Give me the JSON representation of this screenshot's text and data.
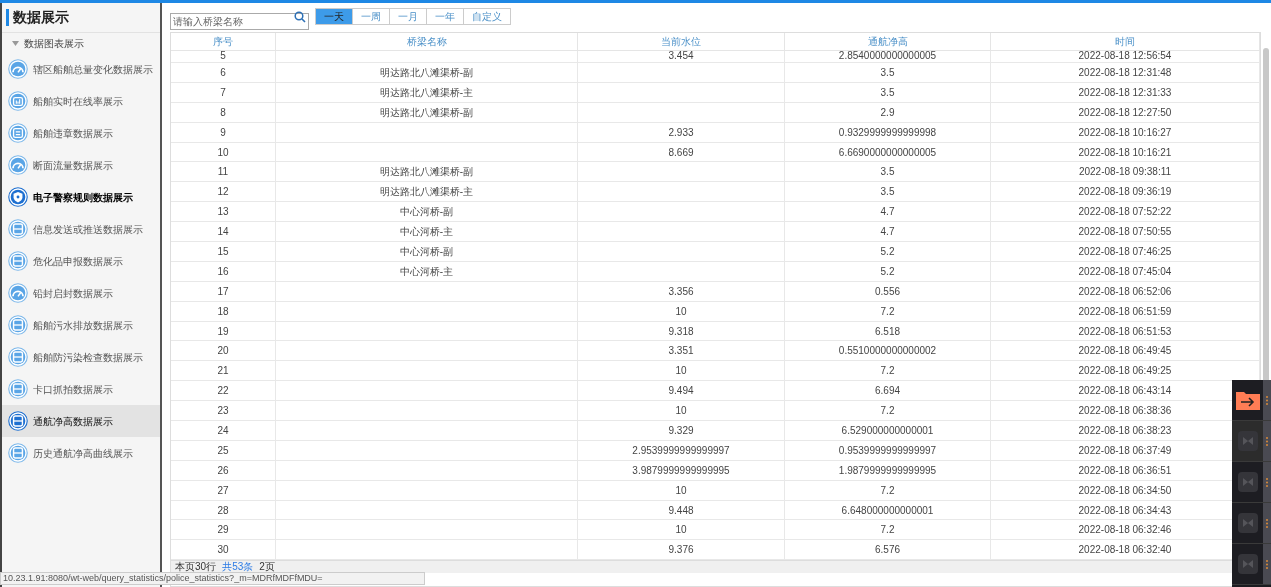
{
  "sidebar": {
    "title": "数据展示",
    "group": {
      "label": "数据图表展示",
      "expanded": true,
      "items": [
        {
          "label": "辖区船舶总量变化数据展示",
          "kind": "gauge",
          "selected": false,
          "emphasized": false
        },
        {
          "label": "船舶实时在线率展示",
          "kind": "bars",
          "selected": false,
          "emphasized": false
        },
        {
          "label": "船舶违章数据展示",
          "kind": "badge",
          "selected": false,
          "emphasized": false
        },
        {
          "label": "断面流量数据展示",
          "kind": "gauge",
          "selected": false,
          "emphasized": false
        },
        {
          "label": "电子警察规则数据展示",
          "kind": "shield",
          "selected": false,
          "emphasized": true
        },
        {
          "label": "信息发送或推送数据展示",
          "kind": "box",
          "selected": false,
          "emphasized": false
        },
        {
          "label": "危化品申报数据展示",
          "kind": "box",
          "selected": false,
          "emphasized": false
        },
        {
          "label": "铅封启封数据展示",
          "kind": "gauge",
          "selected": false,
          "emphasized": false
        },
        {
          "label": "船舶污水排放数据展示",
          "kind": "box",
          "selected": false,
          "emphasized": false
        },
        {
          "label": "船舶防污染检查数据展示",
          "kind": "box",
          "selected": false,
          "emphasized": false
        },
        {
          "label": "卡口抓拍数据展示",
          "kind": "box",
          "selected": false,
          "emphasized": false
        },
        {
          "label": "通航净高数据展示",
          "kind": "box",
          "selected": true,
          "emphasized": false
        },
        {
          "label": "历史通航净高曲线展示",
          "kind": "box",
          "selected": false,
          "emphasized": false
        }
      ]
    }
  },
  "search": {
    "placeholder": "请输入桥梁名称"
  },
  "ranges": [
    {
      "label": "一天",
      "selected": true
    },
    {
      "label": "一周",
      "selected": false
    },
    {
      "label": "一月",
      "selected": false
    },
    {
      "label": "一年",
      "selected": false
    },
    {
      "label": "自定义",
      "selected": false
    }
  ],
  "table": {
    "columns": [
      "序号",
      "桥梁名称",
      "当前水位",
      "通航净高",
      "时间"
    ],
    "rows": [
      [
        "5",
        "",
        "3.454",
        "2.8540000000000005",
        "2022-08-18 12:56:54"
      ],
      [
        "6",
        "明达路北八滩渠桥-副",
        "",
        "3.5",
        "2022-08-18 12:31:48"
      ],
      [
        "7",
        "明达路北八滩渠桥-主",
        "",
        "3.5",
        "2022-08-18 12:31:33"
      ],
      [
        "8",
        "明达路北八滩渠桥-副",
        "",
        "2.9",
        "2022-08-18 12:27:50"
      ],
      [
        "9",
        "",
        "2.933",
        "0.9329999999999998",
        "2022-08-18 10:16:27"
      ],
      [
        "10",
        "",
        "8.669",
        "6.6690000000000005",
        "2022-08-18 10:16:21"
      ],
      [
        "11",
        "明达路北八滩渠桥-副",
        "",
        "3.5",
        "2022-08-18 09:38:11"
      ],
      [
        "12",
        "明达路北八滩渠桥-主",
        "",
        "3.5",
        "2022-08-18 09:36:19"
      ],
      [
        "13",
        "中心河桥-副",
        "",
        "4.7",
        "2022-08-18 07:52:22"
      ],
      [
        "14",
        "中心河桥-主",
        "",
        "4.7",
        "2022-08-18 07:50:55"
      ],
      [
        "15",
        "中心河桥-副",
        "",
        "5.2",
        "2022-08-18 07:46:25"
      ],
      [
        "16",
        "中心河桥-主",
        "",
        "5.2",
        "2022-08-18 07:45:04"
      ],
      [
        "17",
        "",
        "3.356",
        "0.556",
        "2022-08-18 06:52:06"
      ],
      [
        "18",
        "",
        "10",
        "7.2",
        "2022-08-18 06:51:59"
      ],
      [
        "19",
        "",
        "9.318",
        "6.518",
        "2022-08-18 06:51:53"
      ],
      [
        "20",
        "",
        "3.351",
        "0.5510000000000002",
        "2022-08-18 06:49:45"
      ],
      [
        "21",
        "",
        "10",
        "7.2",
        "2022-08-18 06:49:25"
      ],
      [
        "22",
        "",
        "9.494",
        "6.694",
        "2022-08-18 06:43:14"
      ],
      [
        "23",
        "",
        "10",
        "7.2",
        "2022-08-18 06:38:36"
      ],
      [
        "24",
        "",
        "9.329",
        "6.529000000000001",
        "2022-08-18 06:38:23"
      ],
      [
        "25",
        "",
        "2.9539999999999997",
        "0.9539999999999997",
        "2022-08-18 06:37:49"
      ],
      [
        "26",
        "",
        "3.9879999999999995",
        "1.9879999999999995",
        "2022-08-18 06:36:51"
      ],
      [
        "27",
        "",
        "10",
        "7.2",
        "2022-08-18 06:34:50"
      ],
      [
        "28",
        "",
        "9.448",
        "6.648000000000001",
        "2022-08-18 06:34:43"
      ],
      [
        "29",
        "",
        "10",
        "7.2",
        "2022-08-18 06:32:46"
      ],
      [
        "30",
        "",
        "9.376",
        "6.576",
        "2022-08-18 06:32:40"
      ]
    ]
  },
  "pager": {
    "rows_text": "本页30行",
    "total_text": "共53条",
    "pages_text": "2页"
  },
  "status_url": "10.23.1.91:8080/wt-web/query_statistics/police_statistics?_m=MDRfMDFfMDU=",
  "dock": [
    {
      "kind": "folder"
    },
    {
      "kind": "app"
    },
    {
      "kind": "app"
    },
    {
      "kind": "app"
    },
    {
      "kind": "app"
    }
  ]
}
